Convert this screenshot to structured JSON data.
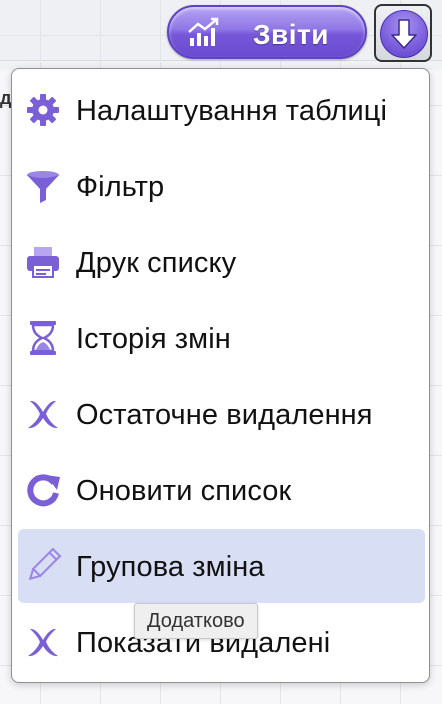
{
  "toolbar": {
    "reports_label": "Звіти",
    "reports_icon": "bar-chart-trend-icon",
    "dropdown_icon": "arrow-down-circle-icon"
  },
  "menu": {
    "items": [
      {
        "label": "Налаштування таблиці",
        "icon": "gear-icon"
      },
      {
        "label": "Фільтр",
        "icon": "funnel-icon"
      },
      {
        "label": "Друк списку",
        "icon": "printer-icon"
      },
      {
        "label": "Історія змін",
        "icon": "hourglass-icon"
      },
      {
        "label": "Остаточне видалення",
        "icon": "x-delete-icon"
      },
      {
        "label": "Оновити список",
        "icon": "refresh-icon"
      },
      {
        "label": "Групова зміна",
        "icon": "pencil-icon"
      },
      {
        "label": "Показати видалені",
        "icon": "x-delete-icon"
      }
    ],
    "highlighted_index": 6
  },
  "tooltip": {
    "text": "Додатково"
  },
  "colors": {
    "accent": "#7a5ddc",
    "icon": "#7b5fd6",
    "highlight": "#d8def4"
  }
}
